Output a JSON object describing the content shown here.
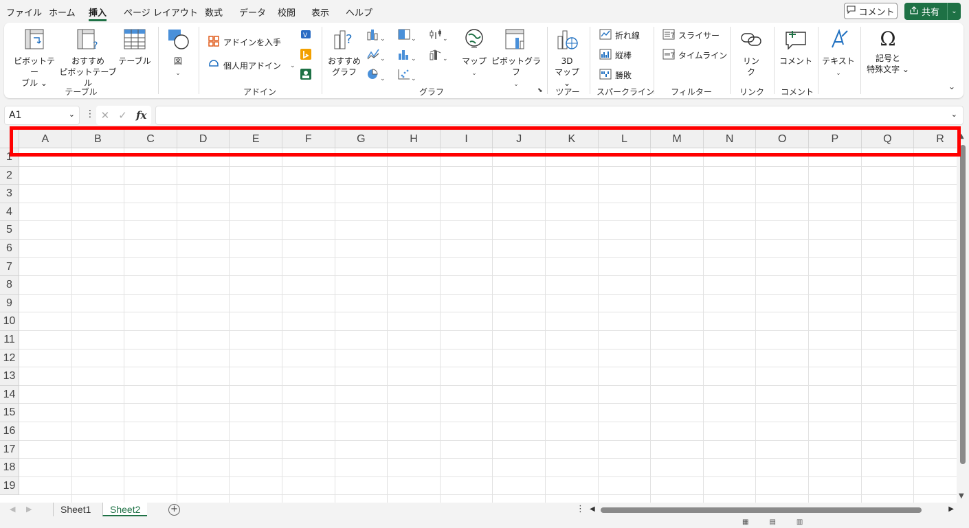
{
  "menu": {
    "tabs": [
      "ファイル",
      "ホーム",
      "挿入",
      "ページ レイアウト",
      "数式",
      "データ",
      "校閲",
      "表示",
      "ヘルプ"
    ],
    "active_tab": "挿入",
    "comment_button": "コメント",
    "share_button": "共有"
  },
  "ribbon": {
    "table_group": {
      "pivot_table": "ピボットテー\nブル ⌄",
      "recommended_pivot": "おすすめ\nピボットテーブル",
      "table": "テーブル",
      "label": "テーブル"
    },
    "illustrations": {
      "figure": "図"
    },
    "addins_group": {
      "get_addins": "アドインを入手",
      "personal_addins": "個人用アドイン",
      "label": "アドイン"
    },
    "charts_group": {
      "recommended_charts": "おすすめ\nグラフ",
      "maps": "マップ",
      "pivot_chart": "ピボットグラフ",
      "label": "グラフ"
    },
    "tours_group": {
      "map3d": "3D\nマップ ⌄",
      "label": "ツアー"
    },
    "sparklines_group": {
      "line": "折れ線",
      "column": "縦棒",
      "winloss": "勝敗",
      "label": "スパークライン"
    },
    "filters_group": {
      "slicer": "スライサー",
      "timeline": "タイムライン",
      "label": "フィルター"
    },
    "links_group": {
      "link": "リン\nク",
      "label": "リンク"
    },
    "comments_group": {
      "comment": "コメント",
      "label": "コメント"
    },
    "text_group": {
      "text": "テキスト"
    },
    "symbols_group": {
      "symbols": "記号と\n特殊文字 ⌄"
    }
  },
  "formula_bar": {
    "name_box": "A1",
    "fx": "fx",
    "value": ""
  },
  "grid": {
    "columns": [
      "A",
      "B",
      "C",
      "D",
      "E",
      "F",
      "G",
      "H",
      "I",
      "J",
      "K",
      "L",
      "M",
      "N",
      "O",
      "P",
      "Q",
      "R"
    ],
    "rows": [
      "1",
      "2",
      "3",
      "4",
      "5",
      "6",
      "7",
      "8",
      "9",
      "10",
      "11",
      "12",
      "13",
      "14",
      "15",
      "16",
      "17",
      "18",
      "19"
    ]
  },
  "sheets": {
    "tabs": [
      "Sheet1",
      "Sheet2"
    ],
    "active": "Sheet2"
  },
  "highlight_color": "#ff0000",
  "accent_color": "#1e7145"
}
